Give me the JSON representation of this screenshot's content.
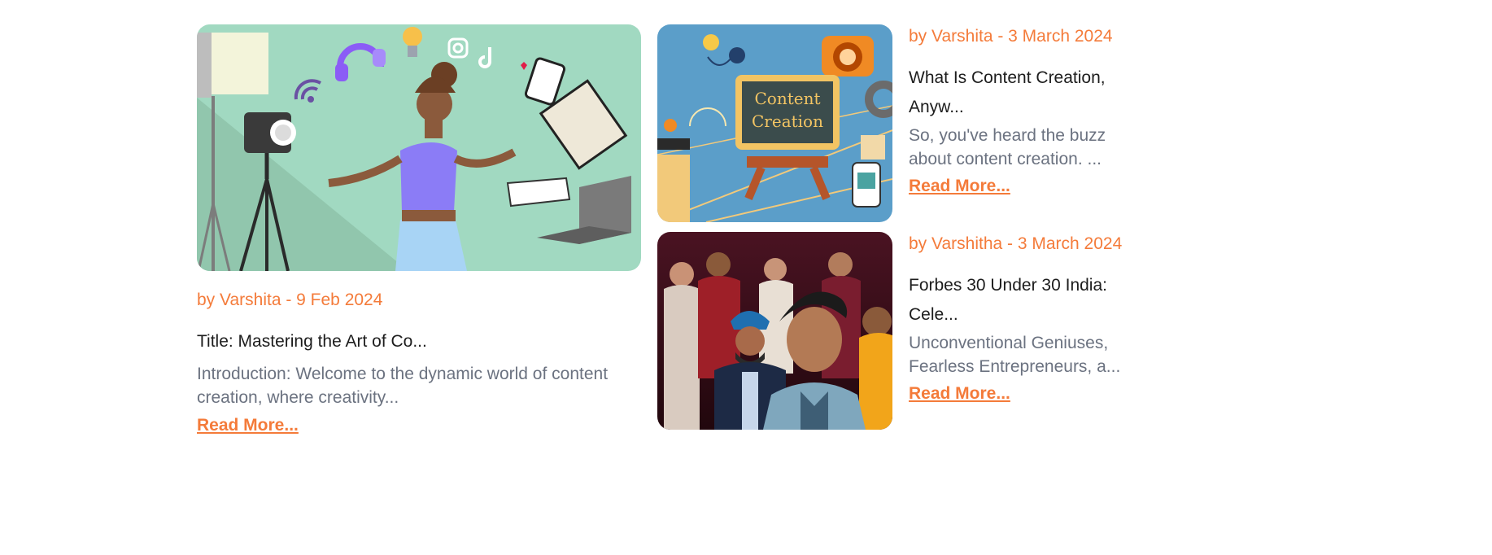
{
  "colors": {
    "accent": "#f47b3a",
    "title": "#1d1d1d",
    "excerpt": "#6b7280"
  },
  "featured": {
    "image_alt": "creator-illustration",
    "meta": "by Varshita - 9 Feb 2024",
    "title": "Title: Mastering the Art of Co...",
    "excerpt": "Introduction: Welcome to the dynamic world of content creation, where creativity...",
    "read_more": "Read More..."
  },
  "posts": [
    {
      "image_alt": "content-creation-illustration",
      "image_text_line1": "Content",
      "image_text_line2": "Creation",
      "meta": "by Varshita - 3 March 2024",
      "title": "What Is Content Creation, Anyw...",
      "excerpt": "So, you've heard the buzz about content creation. ...",
      "read_more": "Read More..."
    },
    {
      "image_alt": "forbes-group-photo",
      "meta": "by Varshitha - 3 March 2024",
      "title": "Forbes 30 Under 30 India: Cele...",
      "excerpt": "Unconventional Geniuses, Fearless Entrepreneurs, a...",
      "read_more": "Read More..."
    }
  ]
}
